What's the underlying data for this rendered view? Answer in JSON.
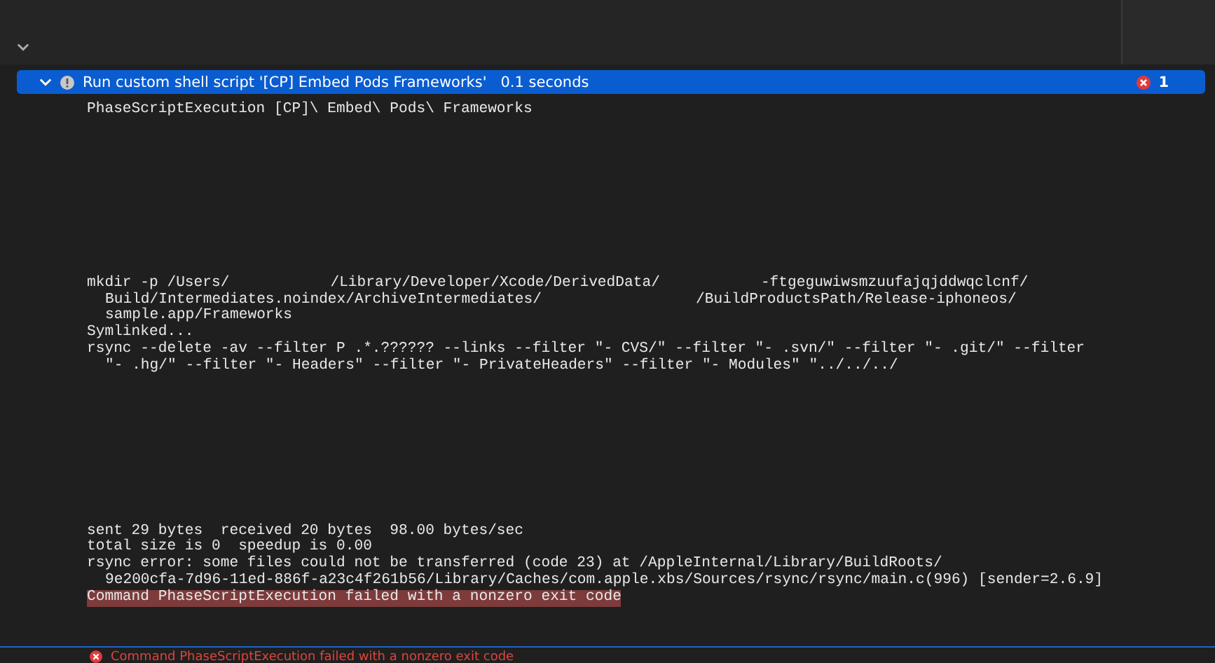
{
  "header": {
    "expanded": true,
    "title": "Run custom shell script '[CP] Embed Pods Frameworks'",
    "duration": "0.1 seconds",
    "error_count": "1"
  },
  "command": "PhaseScriptExecution [CP]\\ Embed\\ Pods\\ Frameworks",
  "output_top": [
    {
      "kind": "plain",
      "segments": [
        "mkdir -p /Users/",
        "/Library/Developer/Xcode/DerivedData/",
        "-ftgeguwiwsmzuufajqjddwqclcnf/"
      ]
    },
    {
      "kind": "continuation",
      "segments": [
        "Build/Intermediates.noindex/ArchiveIntermediates/",
        "/BuildProductsPath/Release-iphoneos/"
      ]
    },
    {
      "kind": "continuation",
      "segments": [
        "sample.app/Frameworks"
      ]
    },
    {
      "kind": "plain",
      "segments": [
        "Symlinked..."
      ]
    },
    {
      "kind": "plain",
      "segments": [
        "rsync --delete -av --filter P .*.?????? --links --filter \"- CVS/\" --filter \"- .svn/\" --filter \"- .git/\" --filter"
      ]
    },
    {
      "kind": "continuation",
      "segments": [
        "\"- .hg/\" --filter \"- Headers\" --filter \"- PrivateHeaders\" --filter \"- Modules\" \"../../../"
      ]
    }
  ],
  "output_bottom": [
    {
      "kind": "plain",
      "segments": [
        "sent 29 bytes  received 20 bytes  98.00 bytes/sec"
      ]
    },
    {
      "kind": "plain",
      "segments": [
        "total size is 0  speedup is 0.00"
      ]
    },
    {
      "kind": "plain",
      "segments": [
        "rsync error: some files could not be transferred (code 23) at /AppleInternal/Library/BuildRoots/"
      ]
    },
    {
      "kind": "continuation",
      "segments": [
        "9e200cfa-7d96-11ed-886f-a23c4f261b56/Library/Caches/com.apple.xbs/Sources/rsync/rsync/main.c(996) [sender=2.6.9]"
      ]
    },
    {
      "kind": "highlighted",
      "segments": [
        "Command PhaseScriptExecution failed with a nonzero exit code"
      ]
    }
  ],
  "error_message": "Command PhaseScriptExecution failed with a nonzero exit code"
}
